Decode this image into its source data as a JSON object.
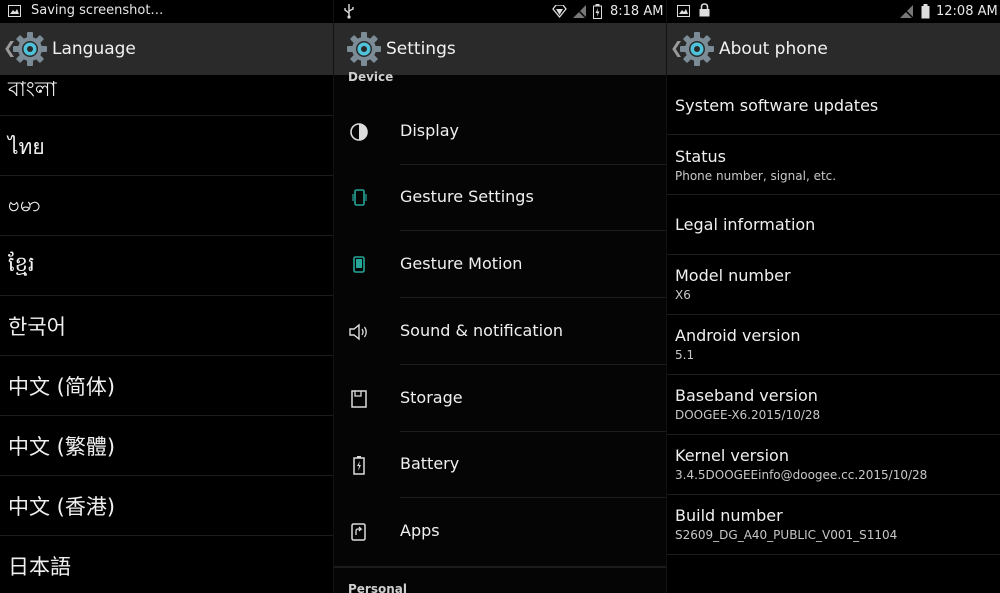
{
  "language_screen": {
    "status_text": "Saving screenshot…",
    "title": "Language",
    "items": [
      "বাংলা",
      "ไทย",
      "ဗမာ",
      "ខ្មែរ",
      "한국어",
      "中文 (简体)",
      "中文 (繁體)",
      "中文 (香港)",
      "日本語"
    ]
  },
  "settings_screen": {
    "time": "8:18 AM",
    "title": "Settings",
    "section_device": "Device",
    "section_personal": "Personal",
    "items": [
      {
        "label": "Display",
        "icon": "brightness-icon"
      },
      {
        "label": "Gesture Settings",
        "icon": "phone-gesture-icon"
      },
      {
        "label": "Gesture Motion",
        "icon": "phone-motion-icon"
      },
      {
        "label": "Sound & notification",
        "icon": "speaker-icon"
      },
      {
        "label": "Storage",
        "icon": "storage-icon"
      },
      {
        "label": "Battery",
        "icon": "battery-icon"
      },
      {
        "label": "Apps",
        "icon": "apps-icon"
      }
    ],
    "accent": "#26a69a"
  },
  "about_screen": {
    "time": "12:08 AM",
    "title": "About phone",
    "items": [
      {
        "title": "System software updates",
        "subtitle": ""
      },
      {
        "title": "Status",
        "subtitle": "Phone number, signal, etc."
      },
      {
        "title": "Legal information",
        "subtitle": ""
      },
      {
        "title": "Model number",
        "subtitle": "X6"
      },
      {
        "title": "Android version",
        "subtitle": "5.1"
      },
      {
        "title": "Baseband version",
        "subtitle": "DOOGEE-X6.2015/10/28"
      },
      {
        "title": "Kernel version",
        "subtitle": "3.4.5DOOGEEinfo@doogee.cc.2015/10/28"
      },
      {
        "title": "Build number",
        "subtitle": "S2609_DG_A40_PUBLIC_V001_S1104"
      }
    ]
  }
}
